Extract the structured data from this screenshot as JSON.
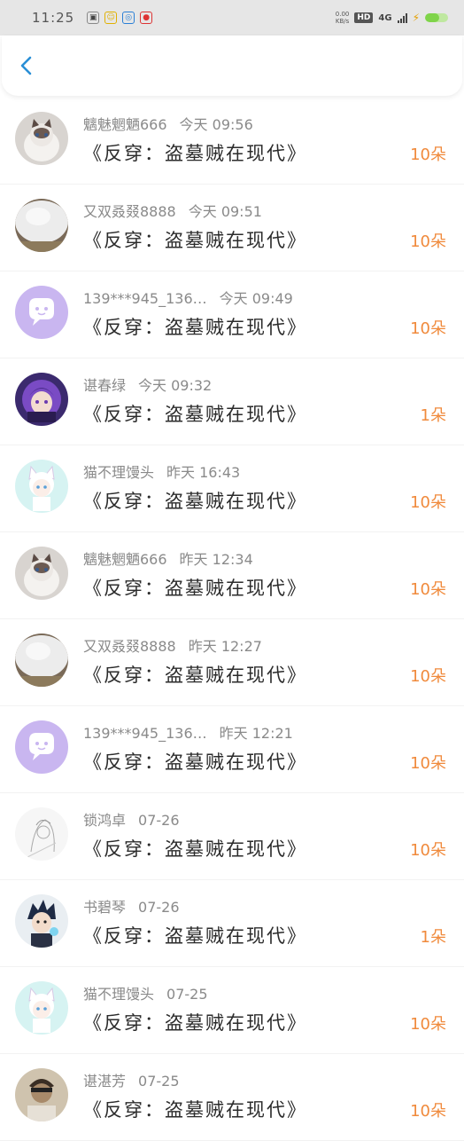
{
  "status_bar": {
    "time": "11:25",
    "net_speed_value": "0.00",
    "net_speed_unit": "KB/s",
    "hd": "HD",
    "network": "4G",
    "battery_level": 0.6,
    "app_icons": [
      "app-icon-1",
      "app-icon-2",
      "app-icon-3",
      "app-icon-4"
    ]
  },
  "header": {
    "back_icon": "chevron-left-icon",
    "accent": "#2a8fd6"
  },
  "colors": {
    "count": "#f08a3c",
    "meta": "#8a8a8a"
  },
  "items": [
    {
      "name": "魑魅魍魉666",
      "time": "今天 09:56",
      "title": "《反穿：盗墓贼在现代》",
      "count": "10朵",
      "avatar": "cat-photo-avatar"
    },
    {
      "name": "又双叒叕8888",
      "time": "今天 09:51",
      "title": "《反穿：盗墓贼在现代》",
      "count": "10朵",
      "avatar": "fluffy-white-avatar"
    },
    {
      "name": "139***945_136…",
      "time": "今天 09:49",
      "title": "《反穿：盗墓贼在现代》",
      "count": "10朵",
      "avatar": "purple-chat-avatar"
    },
    {
      "name": "谌春绿",
      "time": "今天 09:32",
      "title": "《反穿：盗墓贼在现代》",
      "count": "1朵",
      "avatar": "anime-purple-avatar"
    },
    {
      "name": "猫不理馒头",
      "time": "昨天 16:43",
      "title": "《反穿：盗墓贼在现代》",
      "count": "10朵",
      "avatar": "anime-catgirl-avatar"
    },
    {
      "name": "魑魅魍魉666",
      "time": "昨天 12:34",
      "title": "《反穿：盗墓贼在现代》",
      "count": "10朵",
      "avatar": "cat-photo-avatar"
    },
    {
      "name": "又双叒叕8888",
      "time": "昨天 12:27",
      "title": "《反穿：盗墓贼在现代》",
      "count": "10朵",
      "avatar": "fluffy-white-avatar"
    },
    {
      "name": "139***945_136…",
      "time": "昨天 12:21",
      "title": "《反穿：盗墓贼在现代》",
      "count": "10朵",
      "avatar": "purple-chat-avatar"
    },
    {
      "name": "锁鸿卓",
      "time": "07-26",
      "title": "《反穿：盗墓贼在现代》",
      "count": "10朵",
      "avatar": "sketch-avatar"
    },
    {
      "name": "书碧琴",
      "time": "07-26",
      "title": "《反穿：盗墓贼在现代》",
      "count": "1朵",
      "avatar": "anime-boy-avatar"
    },
    {
      "name": "猫不理馒头",
      "time": "07-25",
      "title": "《反穿：盗墓贼在现代》",
      "count": "10朵",
      "avatar": "anime-catgirl-avatar"
    },
    {
      "name": "谌湛芳",
      "time": "07-25",
      "title": "《反穿：盗墓贼在现代》",
      "count": "10朵",
      "avatar": "photo-person-avatar"
    }
  ]
}
